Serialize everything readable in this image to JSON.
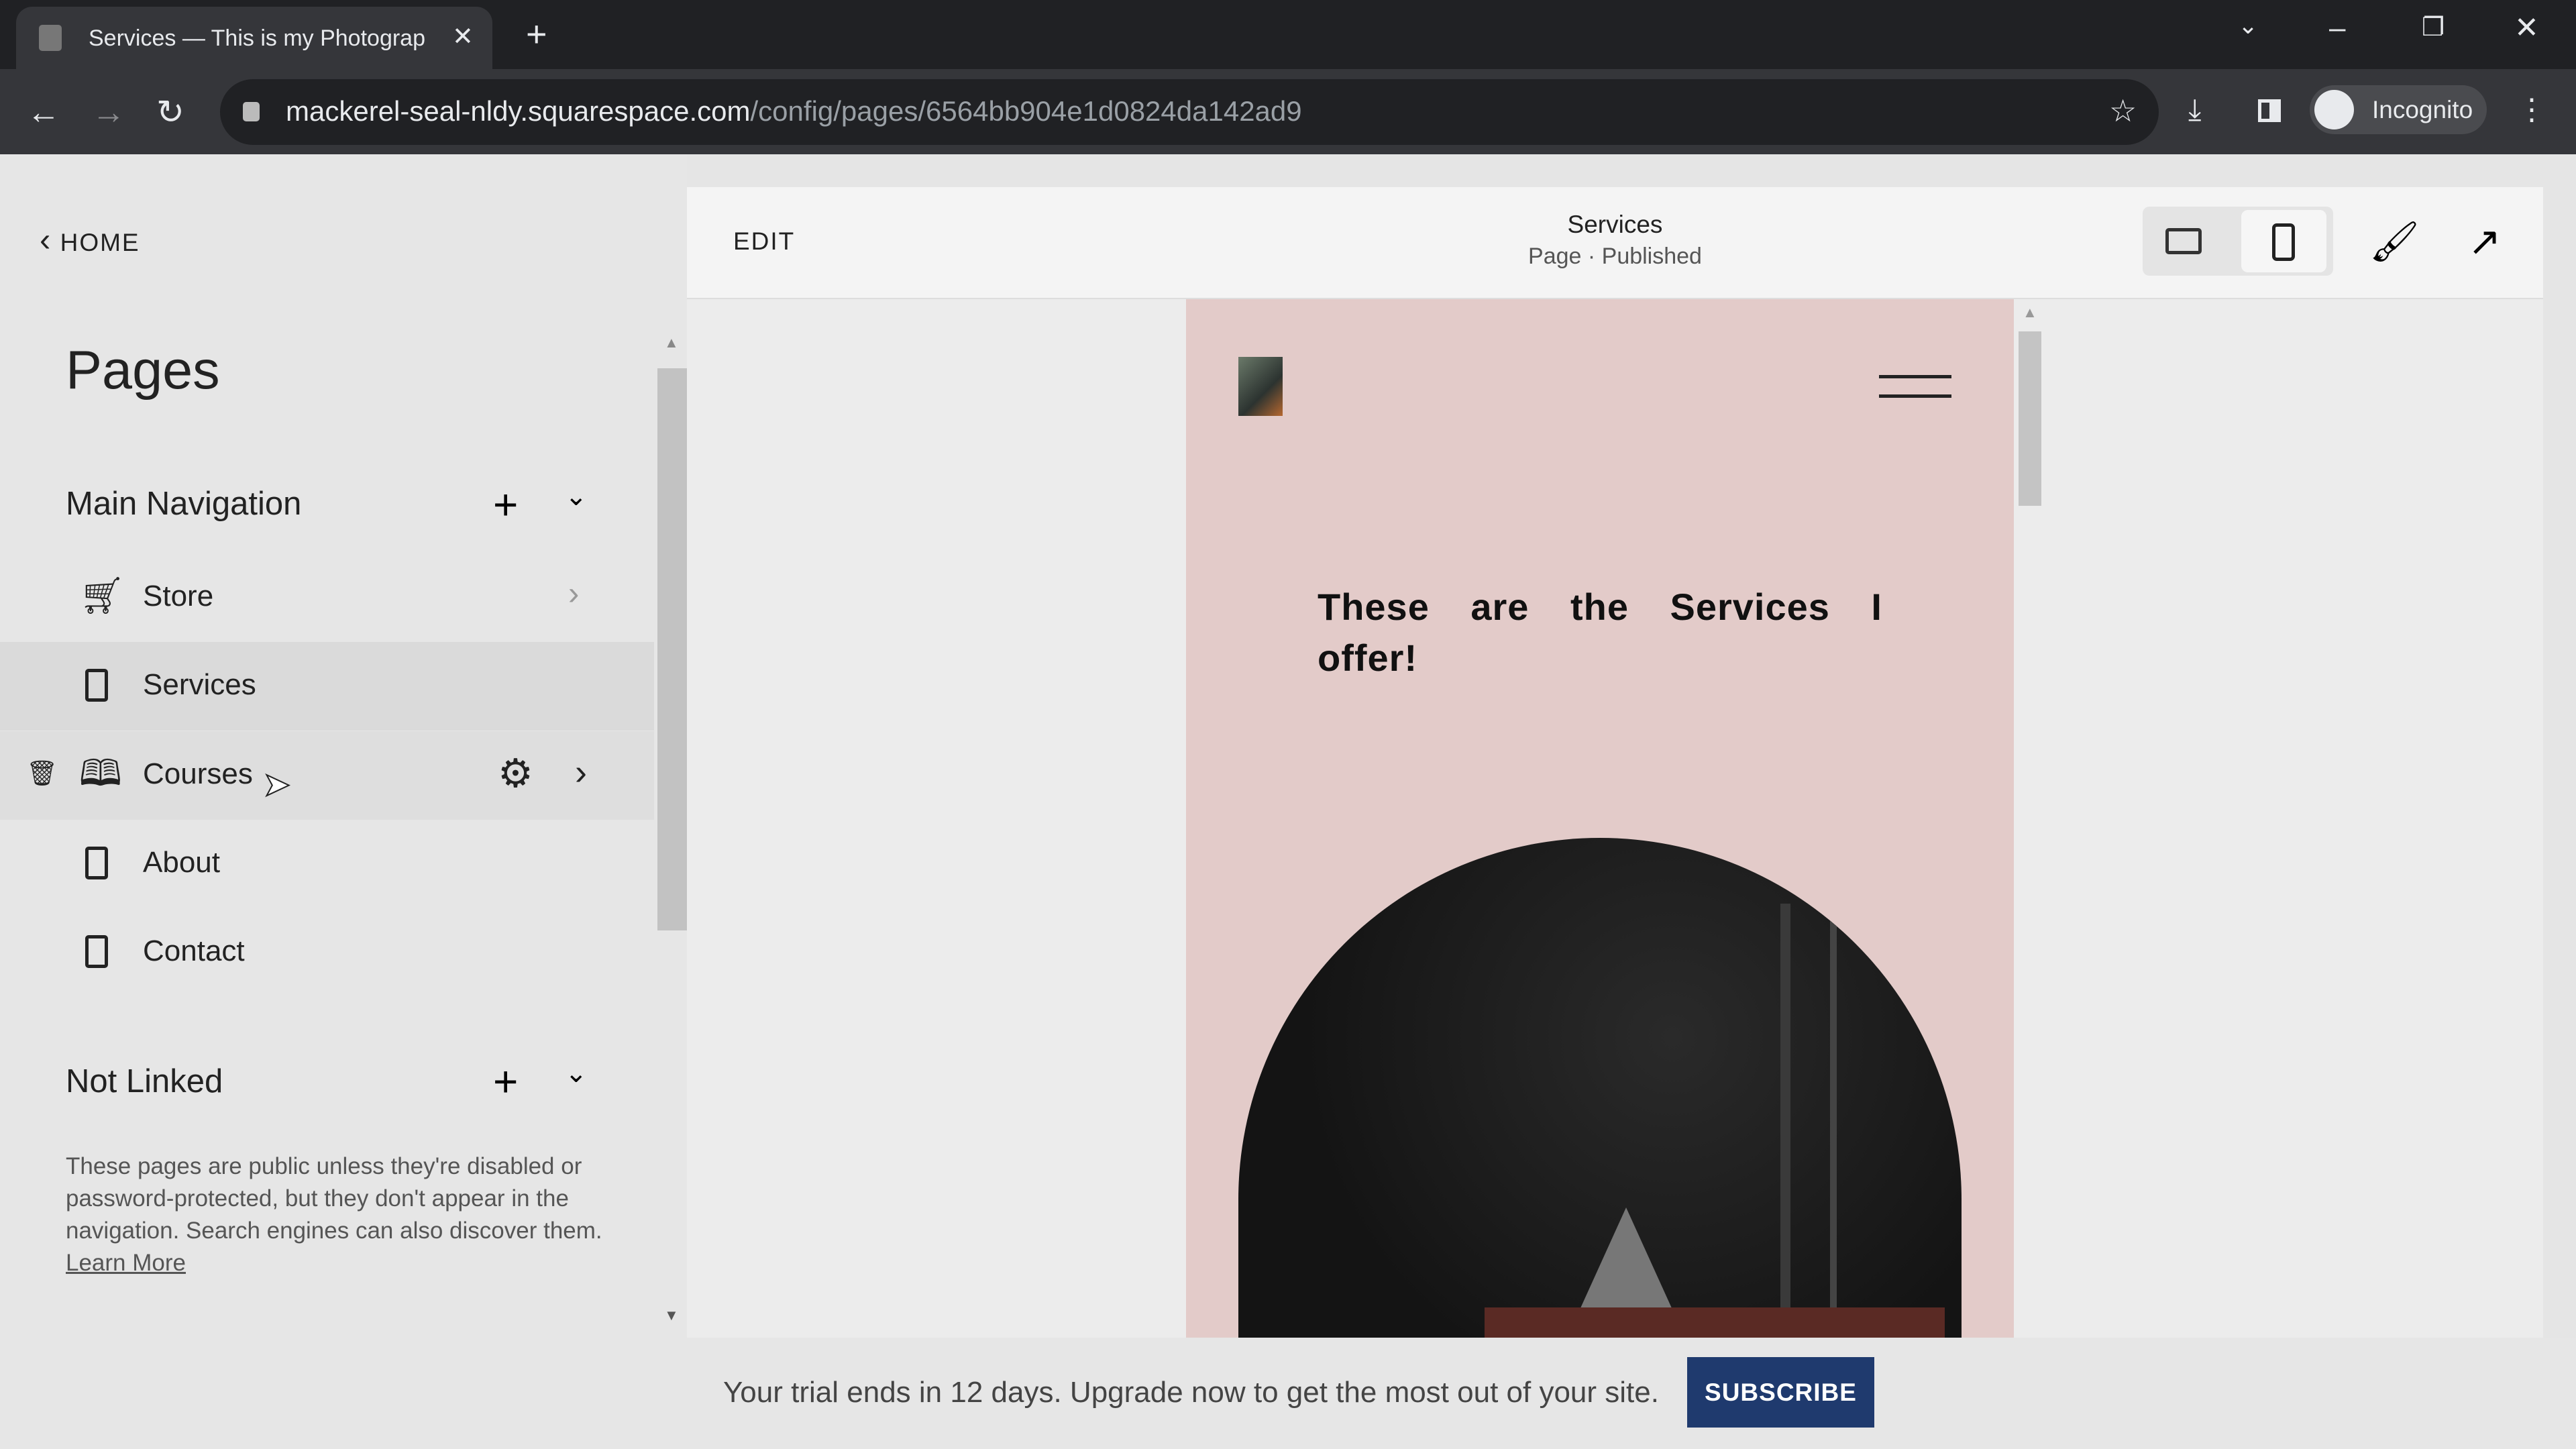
{
  "browser": {
    "tab_title": "Services — This is my Photograp",
    "url_host": "mackerel-seal-nldy.squarespace.com",
    "url_path": "/config/pages/6564bb904e1d0824da142ad9",
    "profile": "Incognito"
  },
  "sidebar": {
    "back_label": "HOME",
    "title": "Pages",
    "main_nav": {
      "title": "Main Navigation",
      "items": [
        {
          "label": "Store",
          "icon": "cart-icon"
        },
        {
          "label": "Services",
          "icon": "page-icon"
        },
        {
          "label": "Courses",
          "icon": "course-icon"
        },
        {
          "label": "About",
          "icon": "page-icon"
        },
        {
          "label": "Contact",
          "icon": "page-icon"
        }
      ]
    },
    "not_linked": {
      "title": "Not Linked",
      "description": "These pages are public unless they're disabled or password-protected, but they don't appear in the navigation. Search engines can also discover them.",
      "learn_more": "Learn More"
    }
  },
  "header": {
    "edit_label": "EDIT",
    "page_title": "Services",
    "page_status": "Page · Published"
  },
  "preview": {
    "heading": "These are the Services I offer!",
    "bg_color": "#e3cbc9"
  },
  "banner": {
    "message": "Your trial ends in 12 days. Upgrade now to get the most out of your site.",
    "subscribe_label": "SUBSCRIBE",
    "button_color": "#1f3a6e"
  }
}
